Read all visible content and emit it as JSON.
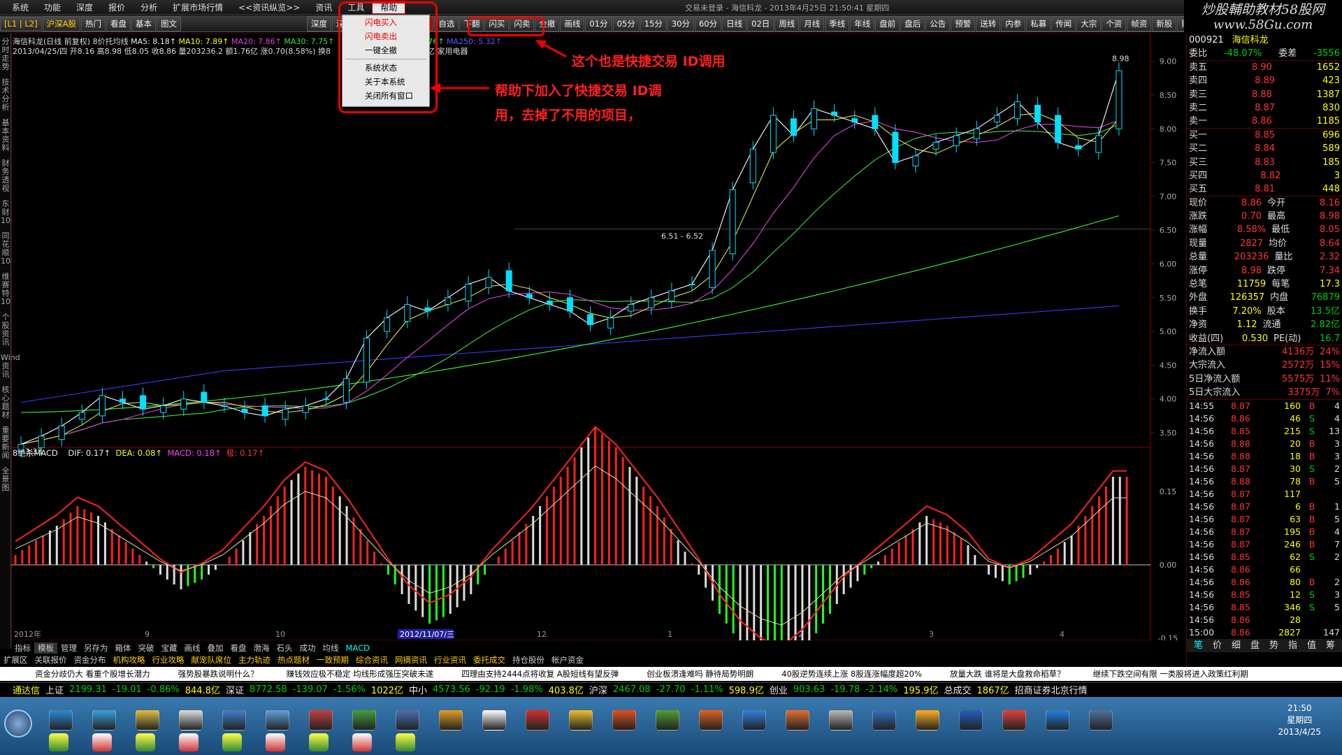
{
  "menubar": {
    "items": [
      "系统",
      "功能",
      "深度",
      "报价",
      "分析",
      "扩展市场行情",
      "<<资讯纵览>>",
      "资讯",
      "工具",
      "帮助"
    ],
    "title": "交易未登录 - 海信科龙 - 2013年4月25日 21:50:41 星期四"
  },
  "logo": {
    "line1": "炒股輔助教材58股网",
    "line2": "www.58Gu.com"
  },
  "toolbar": {
    "items": [
      "[L1 | L2]",
      "沪深A股",
      "热门",
      "看盘",
      "基本",
      "图文",
      "深度",
      "深F9",
      "主力",
      "区间",
      "板块",
      "自选",
      "",
      "",
      "",
      "",
      "",
      "下翻",
      "闪买",
      "闪卖",
      "全撤",
      "画线",
      "01分",
      "05分",
      "15分",
      "30分",
      "60分",
      "日线",
      "02日",
      "周线",
      "月线",
      "季线",
      "年线",
      "盘前",
      "盘后",
      "公告",
      "预警",
      "送转",
      "内参",
      "私募",
      "传闻",
      "大宗",
      "个资",
      "帧资",
      "新股",
      "财经",
      "资"
    ]
  },
  "leftside": [
    "分时走势",
    "技术分析",
    "基本资料",
    "财务透视",
    "东财10",
    "同花顺10",
    "维赛特10",
    "个股资讯",
    "Wind资讯",
    "核心题材",
    "重要新闻",
    "全景图"
  ],
  "info": {
    "line1_name": "海信科龙(日线 前复权) 8价托均线",
    "ma5": "MA5: 8.18↑",
    "ma10": "MA10: 7.89↑",
    "ma20": "MA20: 7.86↑",
    "ma30": "MA30: 7.75↑",
    "ma120": "6.76↑",
    "ma250": "MA250: 5.32↑",
    "line2": "2013/04/25/四 开8.16 高8.98 低8.05 收8.86 量203236.2 额1.76亿 涨0.70(8.58%) 换8",
    "line2b": "2.82亿 家用电器"
  },
  "dropdown": {
    "items": [
      "闪电买入",
      "闪电卖出",
      "一键全撤",
      "系统状态",
      "关于本系统",
      "关闭所有窗口"
    ]
  },
  "annotations": {
    "a1": "这个也是快捷交易 ID调用",
    "a2": "帮助下加入了快捷交易 ID调",
    "a3": "用，去掉了不用的项目，"
  },
  "chart_labels": {
    "high_label": "8.98",
    "low_label": "3.33",
    "mid_label": "6.51 - 6.52",
    "y_ticks": [
      "9.00",
      "8.50",
      "8.00",
      "7.50",
      "7.00",
      "6.50",
      "6.00",
      "5.50",
      "5.00",
      "4.50",
      "4.00",
      "3.50"
    ],
    "macd_ticks": [
      "0.15",
      "0.00",
      "-0.15"
    ],
    "x_labels": [
      "2012年",
      "9",
      "10",
      "11",
      "12",
      "1",
      "2",
      "3",
      "4"
    ],
    "cursor_date": "2012/11/07/三"
  },
  "macd": {
    "title": "8绝杀MACD",
    "dif": "DIF: 0.17↑",
    "dea": "DEA: 0.08↑",
    "macd": "MACD: 0.18↑",
    "pole": "极: 0.17↑"
  },
  "bottomtabs": [
    "指标",
    "模板",
    "管理",
    "另存为",
    "箱体",
    "突破",
    "宝藏",
    "画线",
    "叠加",
    "看盘",
    "渤海",
    "石头",
    "成功",
    "均线",
    "MACD"
  ],
  "bottomtabs2": [
    "扩展区",
    "关联报价",
    "资金分布",
    "机构攻略",
    "行业攻略",
    "献宠队席位",
    "主力轨迹",
    "热点题材",
    "一致预期",
    "综合资讯",
    "网摘资讯",
    "行业资讯",
    "委托成交",
    "持仓股份",
    "帐户资金"
  ],
  "rightpanel": {
    "code": "000921",
    "name": "海信科龙",
    "weibi": [
      "委比",
      "-48.07%",
      "委差",
      "-3556"
    ],
    "asks": [
      [
        "卖五",
        "8.90",
        "1652"
      ],
      [
        "卖四",
        "8.89",
        "423"
      ],
      [
        "卖三",
        "8.88",
        "1387"
      ],
      [
        "卖二",
        "8.87",
        "830"
      ],
      [
        "卖一",
        "8.86",
        "1185"
      ]
    ],
    "bids": [
      [
        "买一",
        "8.85",
        "696"
      ],
      [
        "买二",
        "8.84",
        "589"
      ],
      [
        "买三",
        "8.83",
        "185"
      ],
      [
        "买四",
        "8.82",
        "3"
      ],
      [
        "买五",
        "8.81",
        "448"
      ]
    ],
    "stats": [
      [
        "现价",
        "8.86",
        "今开",
        "8.16"
      ],
      [
        "涨跌",
        "0.70",
        "最高",
        "8.98"
      ],
      [
        "涨幅",
        "8.58%",
        "最低",
        "8.05"
      ],
      [
        "现量",
        "2827",
        "均价",
        "8.64"
      ],
      [
        "总量",
        "203236",
        "量比",
        "2.32"
      ],
      [
        "涨停",
        "8.98",
        "跌停",
        "7.34"
      ],
      [
        "总笔",
        "11759",
        "每笔",
        "17.3"
      ],
      [
        "外盘",
        "126357",
        "内盘",
        "76879"
      ],
      [
        "换手",
        "7.20%",
        "股本",
        "13.5亿"
      ],
      [
        "净资",
        "1.12",
        "流通",
        "2.82亿"
      ],
      [
        "收益(四)",
        "0.530",
        "PE(动)",
        "16.7"
      ]
    ],
    "flows": [
      [
        "净流入额",
        "4136万",
        "24%"
      ],
      [
        "大宗流入",
        "2572万",
        "15%"
      ],
      [
        "5日净流入额",
        "5575万",
        "11%"
      ],
      [
        "5日大宗流入",
        "3375万",
        "7%"
      ]
    ],
    "ticks": [
      [
        "14:55",
        "8.87",
        "160",
        "B",
        "4"
      ],
      [
        "14:56",
        "8.86",
        "46",
        "S",
        "4"
      ],
      [
        "14:56",
        "8.85",
        "215",
        "S",
        "13"
      ],
      [
        "14:56",
        "8.88",
        "20",
        "B",
        "3"
      ],
      [
        "14:56",
        "8.88",
        "18",
        "B",
        "3"
      ],
      [
        "14:56",
        "8.87",
        "30",
        "S",
        "2"
      ],
      [
        "14:56",
        "8.88",
        "78",
        "B",
        "5"
      ],
      [
        "14:56",
        "8.87",
        "117",
        "",
        ""
      ],
      [
        "14:56",
        "8.87",
        "6",
        "B",
        "1"
      ],
      [
        "14:56",
        "8.87",
        "63",
        "B",
        "5"
      ],
      [
        "14:56",
        "8.87",
        "195",
        "B",
        "4"
      ],
      [
        "14:56",
        "8.87",
        "246",
        "B",
        "7"
      ],
      [
        "14:56",
        "8.85",
        "62",
        "S",
        "2"
      ],
      [
        "14:56",
        "8.86",
        "66",
        "",
        ""
      ],
      [
        "14:56",
        "8.86",
        "80",
        "B",
        "2"
      ],
      [
        "14:56",
        "8.85",
        "12",
        "S",
        "3"
      ],
      [
        "14:56",
        "8.85",
        "346",
        "S",
        "5"
      ],
      [
        "14:56",
        "8.86",
        "28",
        "",
        ""
      ],
      [
        "15:00",
        "8.86",
        "2827",
        "",
        "147"
      ]
    ],
    "tabs": [
      "笔",
      "价",
      "细",
      "盘",
      "势",
      "指",
      "值",
      "筹"
    ]
  },
  "news": [
    "资金分歧仍大 看重个股增长潜力",
    "强势股暴跌说明什么？",
    "赚钱效应极不稳定 均线形成强压突破未遂",
    "四理由支持2444点将收复 A股短线有望反弹",
    "创业板溃逢难吗 静待局势明朗",
    "40股逆势连续上涨 8股连涨幅度超20%",
    "放量大跌 谁将是大盘救命稻草？",
    "继续下跌空间有限 一类股将进入政策红利期"
  ],
  "indexbar": {
    "sh": [
      "上证",
      "2199.31",
      "-19.01",
      "-0.86%",
      "844.8亿"
    ],
    "sz": [
      "深证",
      "8772.58",
      "-139.07",
      "-1.56%",
      "1022亿"
    ],
    "zx": [
      "中小",
      "4573.56",
      "-92.19",
      "-1.98%",
      "403.8亿"
    ],
    "hs": [
      "沪深",
      "2467.08",
      "-27.70",
      "-1.11%",
      "598.9亿"
    ],
    "cy": [
      "创业",
      "903.63",
      "-19.78",
      "-2.14%",
      "195.9亿"
    ],
    "total": [
      "总成交",
      "1867亿"
    ],
    "broker": "招商证券北京行情",
    "prefix": "通达信"
  },
  "clock": {
    "time": "21:50",
    "weekday": "星期四",
    "date": "2013/4/25"
  },
  "chart_data": {
    "type": "candlestick",
    "symbol": "000921 海信科龙",
    "period": "日线",
    "ylim": [
      3.2,
      9.1
    ],
    "x_labels": [
      "2012年",
      "9",
      "10",
      "11",
      "12",
      "1",
      "2",
      "3",
      "4"
    ],
    "closes": [
      3.33,
      3.45,
      3.6,
      3.8,
      4.05,
      3.95,
      3.85,
      3.9,
      4.0,
      3.95,
      3.9,
      3.8,
      3.75,
      3.85,
      3.9,
      4.0,
      4.3,
      4.9,
      5.2,
      5.4,
      5.3,
      5.5,
      5.7,
      5.8,
      5.6,
      5.5,
      5.4,
      5.3,
      5.1,
      5.2,
      5.4,
      5.5,
      5.6,
      5.7,
      6.2,
      7.1,
      7.7,
      8.2,
      7.9,
      8.3,
      8.2,
      8.1,
      8.0,
      7.5,
      7.6,
      7.8,
      7.9,
      8.0,
      8.2,
      8.4,
      8.1,
      7.8,
      7.7,
      7.9,
      8.86
    ],
    "ma_lines": [
      {
        "name": "MA250",
        "color": "#3a3aff"
      },
      {
        "name": "MA120",
        "color": "#30ff30"
      },
      {
        "name": "MA30",
        "color": "#40e040"
      },
      {
        "name": "MA20",
        "color": "#e040e0"
      },
      {
        "name": "MA10",
        "color": "#e0e040"
      },
      {
        "name": "MA5",
        "color": "#ffffff"
      }
    ],
    "macd_hist": [
      0.02,
      0.05,
      0.08,
      0.12,
      0.1,
      0.06,
      0.02,
      -0.02,
      -0.05,
      -0.03,
      0.0,
      0.05,
      0.1,
      0.16,
      0.2,
      0.18,
      0.12,
      0.05,
      -0.02,
      -0.08,
      -0.12,
      -0.1,
      -0.06,
      0.0,
      0.05,
      0.1,
      0.16,
      0.22,
      0.28,
      0.24,
      0.18,
      0.12,
      0.05,
      -0.02,
      -0.1,
      -0.16,
      -0.2,
      -0.22,
      -0.18,
      -0.12,
      -0.06,
      -0.02,
      0.02,
      0.06,
      0.1,
      0.08,
      0.04,
      -0.02,
      -0.04,
      -0.02,
      0.02,
      0.06,
      0.12,
      0.18
    ]
  }
}
